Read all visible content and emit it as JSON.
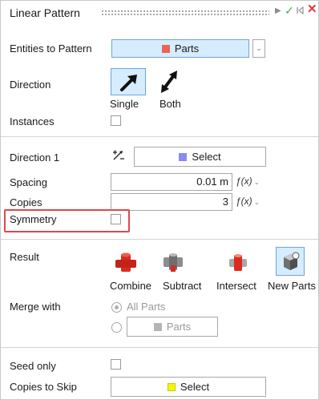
{
  "header": {
    "title": "Linear Pattern",
    "icons": [
      "play-icon",
      "check-icon",
      "reset-icon",
      "close-icon"
    ],
    "colors": {
      "play": "#8c8c8c",
      "check": "#4caf50",
      "reset": "#8c8c8c",
      "close": "#e53935"
    }
  },
  "entities": {
    "label": "Entities to Pattern",
    "value": "Parts",
    "swatch": "#e96552"
  },
  "direction": {
    "label": "Direction",
    "options": [
      {
        "label": "Single",
        "icon": "single-arrow-icon",
        "selected": true
      },
      {
        "label": "Both",
        "icon": "double-arrow-icon",
        "selected": false
      }
    ]
  },
  "instances": {
    "label": "Instances",
    "checked": false
  },
  "direction1": {
    "label": "Direction 1",
    "flip_icon": "flip-direction-icon",
    "value": "Select",
    "swatch": "#8a8af0"
  },
  "spacing": {
    "label": "Spacing",
    "value": "0.01 m",
    "fx": "ƒ(x)"
  },
  "copies": {
    "label": "Copies",
    "value": "3",
    "fx": "ƒ(x)"
  },
  "symmetry": {
    "label": "Symmetry",
    "checked": false,
    "highlight_color": "#e0484a"
  },
  "result": {
    "label": "Result",
    "options": [
      {
        "label": "Combine",
        "icon": "combine-icon",
        "selected": false
      },
      {
        "label": "Subtract",
        "icon": "subtract-icon",
        "selected": false
      },
      {
        "label": "Intersect",
        "icon": "intersect-icon",
        "selected": false
      },
      {
        "label": "New Parts",
        "icon": "new-parts-icon",
        "selected": true
      }
    ]
  },
  "merge": {
    "label": "Merge with",
    "all_parts": "All Parts",
    "parts": "Parts"
  },
  "seed_only": {
    "label": "Seed only",
    "checked": false
  },
  "copies_to_skip": {
    "label": "Copies to Skip",
    "value": "Select",
    "swatch": "#f5f500"
  }
}
